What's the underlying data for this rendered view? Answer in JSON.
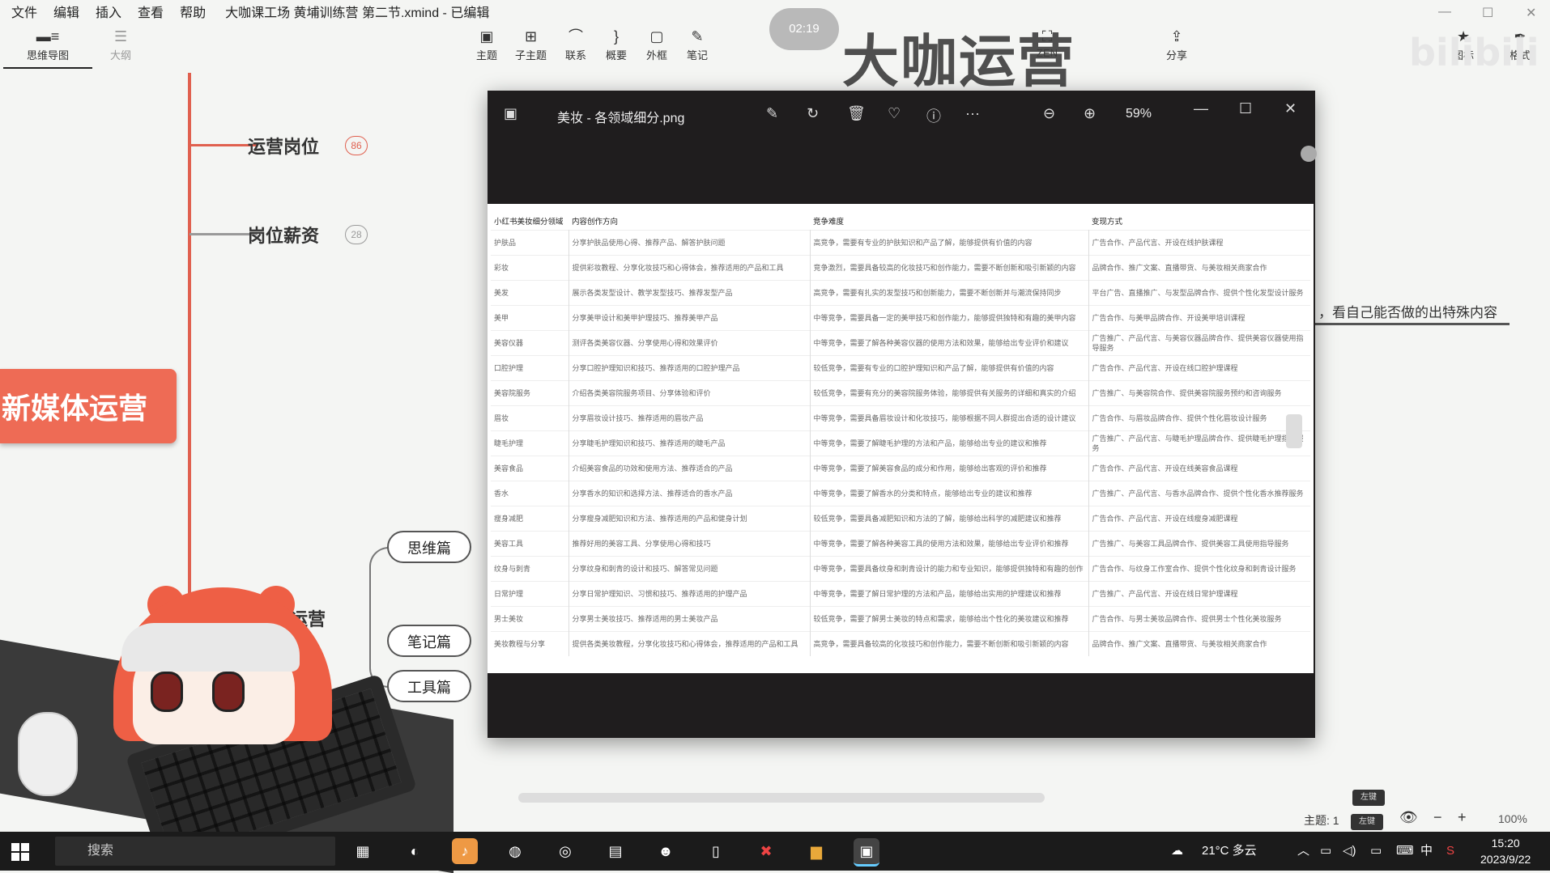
{
  "menu": [
    "文件",
    "编辑",
    "插入",
    "查看",
    "帮助"
  ],
  "doc_title": "大咖课工场 黄埔训练营 第二节.xmind - 已编辑",
  "view_tabs": {
    "mindmap": "思维导图",
    "outline": "大纲"
  },
  "toolbar": {
    "topic": "主题",
    "subtopic": "子主题",
    "relation": "联系",
    "summary": "概要",
    "boundary": "外框",
    "note": "笔记",
    "zen": "ZEN",
    "share": "分享",
    "icon": "图标",
    "format": "格式"
  },
  "timer": "02:19",
  "brand": "大咖运营",
  "watermark": "bilibili",
  "mindmap": {
    "branch1": {
      "label": "运营岗位",
      "count": "86"
    },
    "branch2": {
      "label": "岗位薪资",
      "count": "28"
    },
    "root": "新媒体运营",
    "branch3_partial": "书运营",
    "sub_nodes": [
      "思维篇",
      "笔记篇",
      "工具篇"
    ],
    "side_text": "，看自己能否做的出特殊内容"
  },
  "viewer": {
    "title": "美妆 - 各领域细分.png",
    "zoom": "59%"
  },
  "table": {
    "headers": [
      "小红书美妆细分领域",
      "内容创作方向",
      "竞争难度",
      "变现方式"
    ],
    "rows": [
      [
        "护肤品",
        "分享护肤品使用心得、推荐产品、解答护肤问题",
        "高竞争，需要有专业的护肤知识和产品了解，能够提供有价值的内容",
        "广告合作、产品代言、开设在线护肤课程"
      ],
      [
        "彩妆",
        "提供彩妆教程、分享化妆技巧和心得体会，推荐适用的产品和工具",
        "竞争激烈，需要具备较高的化妆技巧和创作能力，需要不断创新和吸引新颖的内容",
        "品牌合作、推广文案、直播带货、与美妆相关商家合作"
      ],
      [
        "美发",
        "展示各类发型设计、教学发型技巧、推荐发型产品",
        "高竞争，需要有扎实的发型技巧和创新能力，需要不断创新并与潮流保持同步",
        "平台广告、直播推广、与发型品牌合作、提供个性化发型设计服务"
      ],
      [
        "美甲",
        "分享美甲设计和美甲护理技巧、推荐美甲产品",
        "中等竞争，需要具备一定的美甲技巧和创作能力，能够提供独特和有趣的美甲内容",
        "广告合作、与美甲品牌合作、开设美甲培训课程"
      ],
      [
        "美容仪器",
        "测评各类美容仪器、分享使用心得和效果评价",
        "中等竞争，需要了解各种美容仪器的使用方法和效果，能够给出专业评价和建议",
        "广告推广、产品代言、与美容仪器品牌合作、提供美容仪器使用指导服务"
      ],
      [
        "口腔护理",
        "分享口腔护理知识和技巧、推荐适用的口腔护理产品",
        "较低竞争，需要有专业的口腔护理知识和产品了解，能够提供有价值的内容",
        "广告合作、产品代言、开设在线口腔护理课程"
      ],
      [
        "美容院服务",
        "介绍各类美容院服务项目、分享体验和评价",
        "较低竞争，需要有充分的美容院服务体验，能够提供有关服务的详细和真实的介绍",
        "广告推广、与美容院合作、提供美容院服务预约和咨询服务"
      ],
      [
        "眉妆",
        "分享眉妆设计技巧、推荐适用的眉妆产品",
        "中等竞争，需要具备眉妆设计和化妆技巧，能够根据不同人群提出合适的设计建议",
        "广告合作、与眉妆品牌合作、提供个性化眉妆设计服务"
      ],
      [
        "睫毛护理",
        "分享睫毛护理知识和技巧、推荐适用的睫毛产品",
        "中等竞争，需要了解睫毛护理的方法和产品，能够给出专业的建议和推荐",
        "广告推广、产品代言、与睫毛护理品牌合作、提供睫毛护理指导服务"
      ],
      [
        "美容食品",
        "介绍美容食品的功效和使用方法、推荐适合的产品",
        "中等竞争，需要了解美容食品的成分和作用，能够给出客观的评价和推荐",
        "广告合作、产品代言、开设在线美容食品课程"
      ],
      [
        "香水",
        "分享香水的知识和选择方法、推荐适合的香水产品",
        "中等竞争，需要了解香水的分类和特点，能够给出专业的建议和推荐",
        "广告推广、产品代言、与香水品牌合作、提供个性化香水推荐服务"
      ],
      [
        "瘦身减肥",
        "分享瘦身减肥知识和方法、推荐适用的产品和健身计划",
        "较低竞争，需要具备减肥知识和方法的了解，能够给出科学的减肥建议和推荐",
        "广告合作、产品代言、开设在线瘦身减肥课程"
      ],
      [
        "美容工具",
        "推荐好用的美容工具、分享使用心得和技巧",
        "中等竞争，需要了解各种美容工具的使用方法和效果，能够给出专业评价和推荐",
        "广告推广、与美容工具品牌合作、提供美容工具使用指导服务"
      ],
      [
        "纹身与刺青",
        "分享纹身和刺青的设计和技巧、解答常见问题",
        "中等竞争，需要具备纹身和刺青设计的能力和专业知识，能够提供独特和有趣的创作",
        "广告合作、与纹身工作室合作、提供个性化纹身和刺青设计服务"
      ],
      [
        "日常护理",
        "分享日常护理知识、习惯和技巧、推荐适用的护理产品",
        "中等竞争，需要了解日常护理的方法和产品，能够给出实用的护理建议和推荐",
        "广告推广、产品代言、开设在线日常护理课程"
      ],
      [
        "男士美妆",
        "分享男士美妆技巧、推荐适用的男士美妆产品",
        "较低竞争，需要了解男士美妆的特点和需求，能够给出个性化的美妆建议和推荐",
        "广告合作、与男士美妆品牌合作、提供男士个性化美妆服务"
      ],
      [
        "美妆教程与分享",
        "提供各类美妆教程，分享化妆技巧和心得体会，推荐适用的产品和工具",
        "高竞争，需要具备较高的化妆技巧和创作能力，需要不断创新和吸引新颖的内容",
        "品牌合作、推广文案、直播带货、与美妆相关商家合作"
      ]
    ]
  },
  "status": {
    "topic_count": "主题: 1",
    "zoom": "100%",
    "tag1": "左键",
    "tag2": "左键"
  },
  "taskbar": {
    "search": "搜索",
    "weather": "21°C 多云",
    "ime": "中",
    "time": "15:20",
    "date": "2023/9/22"
  }
}
